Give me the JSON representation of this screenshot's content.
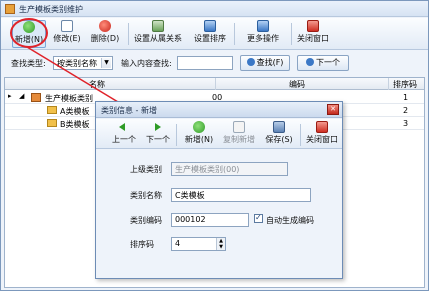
{
  "window": {
    "title": "生产模板类别维护"
  },
  "toolbar": {
    "new": "新增(N)",
    "edit": "修改(E)",
    "delete": "删除(D)",
    "set_relation": "设置从属关系",
    "set_sort": "设置排序",
    "more": "更多操作",
    "close": "关闭窗口"
  },
  "search": {
    "type_label": "查找类型:",
    "type_value": "按类别名称",
    "input_label": "输入内容查找:",
    "input_value": "",
    "find_button": "查找(F)",
    "next_button": "下一个"
  },
  "grid": {
    "columns": [
      "名称",
      "编码",
      "排序码"
    ],
    "rows": [
      {
        "name": "生产模板类别",
        "code": "00",
        "sort": "1"
      },
      {
        "name": "A类模板",
        "code": "",
        "sort": "2"
      },
      {
        "name": "B类模板",
        "code": "",
        "sort": "3"
      }
    ]
  },
  "dialog": {
    "title": "类别信息 - 新增",
    "toolbar": {
      "prev": "上一个",
      "next": "下一个",
      "new": "新增(N)",
      "copy_new": "复制新增",
      "save": "保存(S)",
      "close": "关闭窗口"
    },
    "fields": {
      "parent_label": "上级类别",
      "parent_value": "生产模板类别(00)",
      "name_label": "类别名称",
      "name_value": "C类模板",
      "code_label": "类别编码",
      "code_value": "000102",
      "auto_code_label": "自动生成编码",
      "auto_code_checked": true,
      "sort_label": "排序码",
      "sort_value": "4"
    }
  }
}
